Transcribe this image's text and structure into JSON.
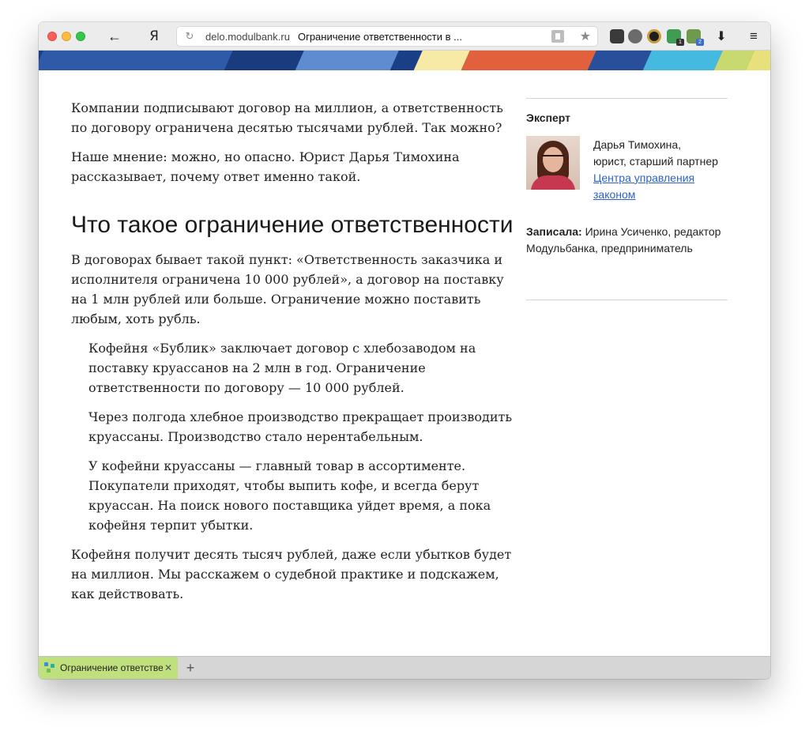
{
  "browser": {
    "back_icon": "←",
    "yandex_icon": "Я",
    "reload_icon": "↻",
    "url_domain": "delo.modulbank.ru",
    "url_title": "Ограничение ответственности в ...",
    "bookmark_icon": "★",
    "download_icon": "⬇",
    "menu_icon": "≡",
    "extensions": [
      {
        "name": "evernote-icon"
      },
      {
        "name": "ghostery-icon"
      },
      {
        "name": "camera-icon"
      },
      {
        "name": "adblock-icon",
        "badge": "1"
      },
      {
        "name": "android-icon",
        "badge": "2"
      }
    ]
  },
  "banner_colors": [
    "#2e5aa8",
    "#1a3c7e",
    "#5f8bd0",
    "#f7e9a6",
    "#e0613c",
    "#2a4f9a",
    "#46b9e0",
    "#c8d96f",
    "#e8e07a",
    "#dce970"
  ],
  "article": {
    "intro_1": "Компании подписывают договор на миллион, а ответственность по договору ограничена десятью тысячами рублей. Так можно?",
    "intro_2": "Наше мнение: можно, но опасно. Юрист Дарья Тимохина рассказывает, почему ответ именно такой.",
    "heading": "Что такое ограничение ответственности",
    "para_1": "В договорах бывает такой пункт: «Ответственность заказчика и исполнителя ограничена 10 000 рублей», а договор на поставку на 1 млн рублей или больше. Ограничение можно поставить любым, хоть рубль.",
    "example_1": "Кофейня «Бублик» заключает договор с хлебозаводом на поставку круассанов на 2 млн в год. Ограничение ответственности по договору — 10 000 рублей.",
    "example_2": "Через полгода хлебное производство прекращает производить круассаны. Производство стало нерентабельным.",
    "example_3": "У кофейни круассаны — главный товар в ассортименте. Покупатели приходят, чтобы выпить кофе, и всегда берут круассан. На поиск нового поставщика уйдет время, а пока кофейня терпит убытки.",
    "para_2": "Кофейня получит десять тысяч рублей, даже если убытков будет на миллион. Мы расскажем о судебной практике и подскажем, как действовать."
  },
  "sidebar": {
    "expert_label": "Эксперт",
    "expert_name": "Дарья Тимохина,",
    "expert_role": "юрист, старший партнер",
    "expert_link": "Центра управления законом",
    "author_label": "Записала:",
    "author_text": "Ирина Усиченко, редактор Модульбанка, предприниматель"
  },
  "tabs": [
    {
      "title": "Ограничение ответственности",
      "close_icon": "✕"
    }
  ],
  "new_tab_icon": "+"
}
